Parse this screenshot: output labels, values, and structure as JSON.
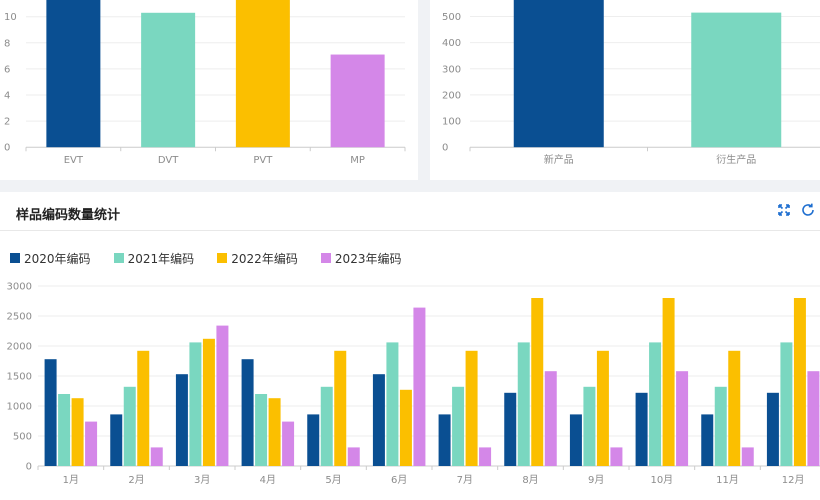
{
  "colors": {
    "c2020": "#0a4f92",
    "c2021": "#7ad7c0",
    "c2022": "#fbbf00",
    "c2023": "#d487e8",
    "grid": "#eeeeee",
    "axis": "#cccccc",
    "tick_text": "#8c8c8c"
  },
  "monthly_card": {
    "title": "样品编码数量统计",
    "fullscreen_icon": "expand-icon",
    "refresh_icon": "refresh-icon"
  },
  "chart_data": [
    {
      "type": "bar",
      "categories": [
        "EVT",
        "DVT",
        "PVT",
        "MP"
      ],
      "values": [
        12.4,
        10.3,
        12.6,
        7.1
      ],
      "bar_colors": [
        "#0a4f92",
        "#7ad7c0",
        "#fbbf00",
        "#d487e8"
      ],
      "yticks": [
        0,
        2,
        4,
        6,
        8,
        10
      ],
      "ylim": [
        0,
        12
      ],
      "grid": true
    },
    {
      "type": "bar",
      "categories": [
        "新产品",
        "衍生产品"
      ],
      "values": [
        660,
        515
      ],
      "bar_colors": [
        "#0a4f92",
        "#7ad7c0"
      ],
      "yticks": [
        0,
        100,
        200,
        300,
        400,
        500
      ],
      "ylim": [
        0,
        600
      ],
      "grid": true
    },
    {
      "type": "bar",
      "title": "样品编码数量统计",
      "categories": [
        "1月",
        "2月",
        "3月",
        "4月",
        "5月",
        "6月",
        "7月",
        "8月",
        "9月",
        "10月",
        "11月",
        "12月"
      ],
      "series": [
        {
          "name": "2020年编码",
          "color": "#0a4f92",
          "values": [
            1780,
            860,
            1530,
            1780,
            860,
            1530,
            860,
            1220,
            860,
            1220,
            860,
            1220
          ]
        },
        {
          "name": "2021年编码",
          "color": "#7ad7c0",
          "values": [
            1200,
            1320,
            2060,
            1200,
            1320,
            2060,
            1320,
            2060,
            1320,
            2060,
            1320,
            2060
          ]
        },
        {
          "name": "2022年编码",
          "color": "#fbbf00",
          "values": [
            1130,
            1920,
            2120,
            1130,
            1920,
            1270,
            1920,
            2800,
            1920,
            2800,
            1920,
            2800
          ]
        },
        {
          "name": "2023年编码",
          "color": "#d487e8",
          "values": [
            740,
            310,
            2340,
            740,
            310,
            2640,
            310,
            1580,
            310,
            1580,
            310,
            1580
          ]
        }
      ],
      "yticks": [
        0,
        500,
        1000,
        1500,
        2000,
        2500,
        3000
      ],
      "ylim": [
        0,
        3000
      ],
      "legend_position": "top-left",
      "grid": true
    }
  ]
}
